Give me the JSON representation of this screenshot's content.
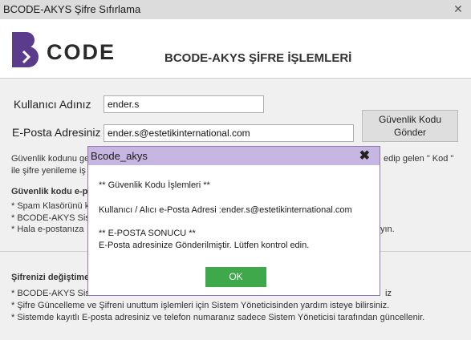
{
  "window": {
    "title": "BCODE-AKYS Şifre Sıfırlama",
    "close_glyph": "✕"
  },
  "header": {
    "logo_text": "CODE",
    "page_title": "BCODE-AKYS ŞİFRE İŞLEMLERİ",
    "brand_color": "#5a3b8c"
  },
  "form": {
    "username_label": "Kullanıcı Adınız",
    "username_value": "ender.s",
    "email_label": "E-Posta Adresiniz",
    "email_value": "ender.s@estetikinternational.com",
    "send_button_line1": "Güvenlik Kodu",
    "send_button_line2": "Gönder"
  },
  "info": {
    "line1_left": "Güvenlik kodunu ge",
    "line1_right": "edip gelen  \" Kod \"",
    "line2": "ile şifre yenileme iş",
    "heading": "Güvenlik kodu e-po",
    "bullet1": "* Spam Klasörünü k",
    "bullet2": "* BCODE-AKYS Sis",
    "bullet3_left": "* Hala e-postanıza",
    "bullet3_right": "yın."
  },
  "bottom": {
    "heading": "Şifrenizi değiştime",
    "bullet1_left": "* BCODE-AKYS Sis",
    "bullet1_right": "iz",
    "bullet2": "* Şifre Güncelleme ve Şifreni unuttum işlemleri için Sistem Yöneticisinden yardım isteye bilirsiniz.",
    "bullet3": "* Sistemde kayıtlı E-posta adresiniz ve telefon numaranız sadece Sistem Yöneticisi tarafından güncellenir."
  },
  "dialog": {
    "title": "Bcode_akys",
    "close_glyph": "✖",
    "line1": "** Güvenlik Kodu İşlemleri **",
    "line2": "Kullanıcı / Alıcı e-Posta Adresi :ender.s@estetikinternational.com",
    "line3": "** E-POSTA SONUCU **",
    "line4": "E-Posta adresinize Gönderilmiştir. Lütfen kontrol edin.",
    "ok_label": "OK",
    "accent_color": "#c8b6e2",
    "ok_color": "#3fa84a"
  }
}
